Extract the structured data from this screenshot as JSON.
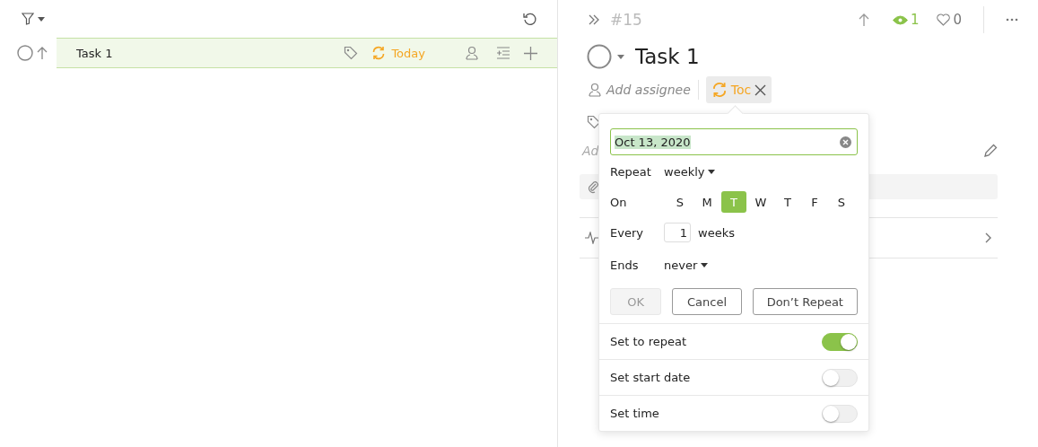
{
  "list": {
    "tasks": [
      {
        "title": "Task 1",
        "due": "Today",
        "selected": true
      }
    ]
  },
  "detail": {
    "number": "#15",
    "watchers": "1",
    "watching": true,
    "likes": "0",
    "title": "Task 1",
    "assignee_placeholder": "Add assignee",
    "due_chip": "Toc",
    "hidden_field": "Ad"
  },
  "repeat_popover": {
    "date": "Oct 13, 2020",
    "repeat_label": "Repeat",
    "repeat_value": "weekly",
    "on_label": "On",
    "days": [
      {
        "label": "S",
        "selected": false
      },
      {
        "label": "M",
        "selected": false
      },
      {
        "label": "T",
        "selected": true
      },
      {
        "label": "W",
        "selected": false
      },
      {
        "label": "T",
        "selected": false
      },
      {
        "label": "F",
        "selected": false
      },
      {
        "label": "S",
        "selected": false
      }
    ],
    "every_label": "Every",
    "every_value": "1",
    "every_unit": "weeks",
    "ends_label": "Ends",
    "ends_value": "never",
    "buttons": [
      {
        "label": "OK",
        "disabled": true
      },
      {
        "label": "Cancel",
        "disabled": false
      },
      {
        "label": "Don’t Repeat",
        "disabled": false
      }
    ],
    "toggles": [
      {
        "label": "Set to repeat",
        "on": true
      },
      {
        "label": "Set start date",
        "on": false
      },
      {
        "label": "Set time",
        "on": false
      }
    ]
  }
}
